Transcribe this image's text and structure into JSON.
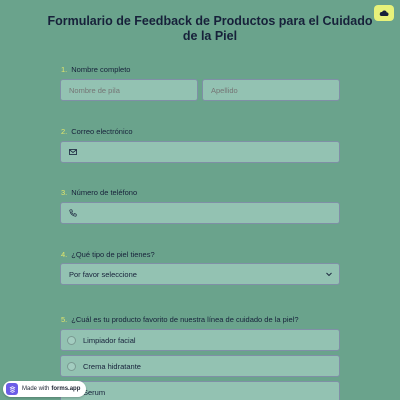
{
  "form": {
    "title": "Formulario de Feedback de Productos para el Cuidado de la Piel",
    "accent_color": "#e4e86a",
    "background_color": "#6aa38c"
  },
  "questions": [
    {
      "number": "1.",
      "label": "Nombre completo",
      "first_placeholder": "Nombre de pila",
      "last_placeholder": "Apellido"
    },
    {
      "number": "2.",
      "label": "Correo electrónico",
      "icon": "mail-icon"
    },
    {
      "number": "3.",
      "label": "Número de teléfono",
      "icon": "phone-icon"
    },
    {
      "number": "4.",
      "label": "¿Qué tipo de piel tienes?",
      "selected_value": "Por favor seleccione",
      "icon": "chevron-down-icon"
    },
    {
      "number": "5.",
      "label": "¿Cuál es tu producto favorito de nuestra línea de cuidado de la piel?",
      "options": [
        "Limpiador facial",
        "Crema hidratante",
        "Serum"
      ]
    }
  ],
  "badge": {
    "prefix": "Made with",
    "brand": "forms.app"
  }
}
